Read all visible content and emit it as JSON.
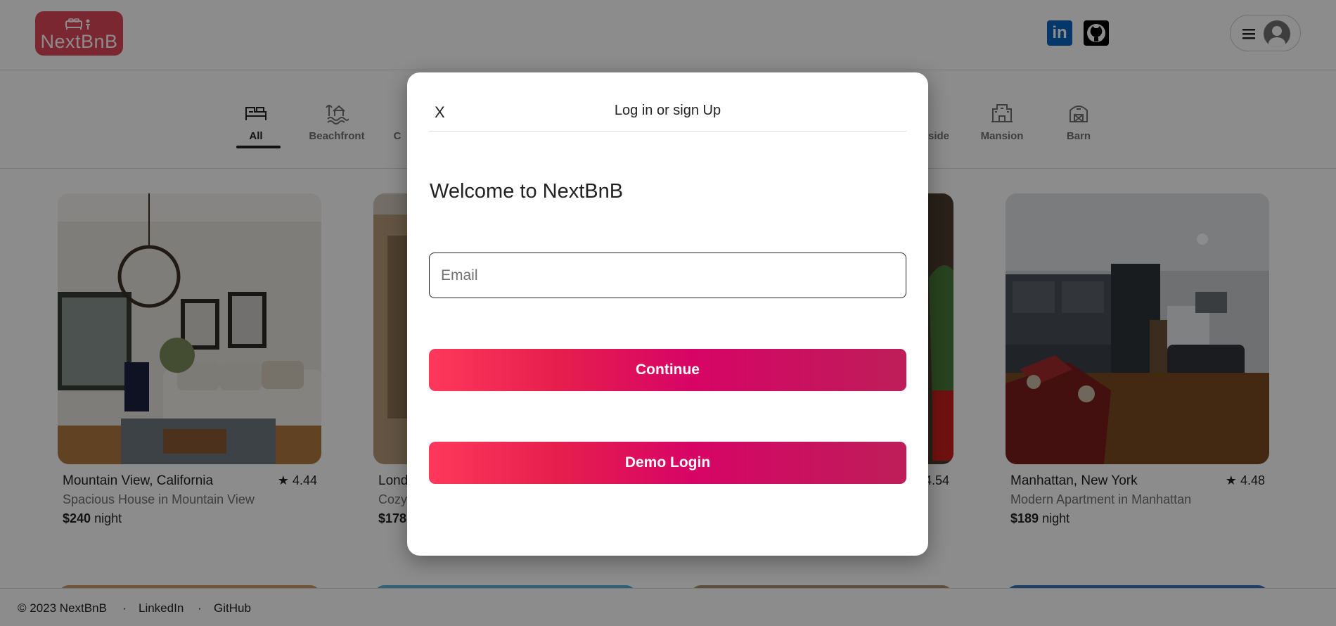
{
  "header": {
    "logo_text": "NextBnB",
    "linkedin_text": "in"
  },
  "categories": [
    {
      "label": "All",
      "icon": "bed-icon",
      "active": true
    },
    {
      "label": "Beachfront",
      "icon": "beach-icon"
    },
    {
      "label": "Mansion",
      "icon": "mansion-icon"
    },
    {
      "label": "Barn",
      "icon": "barn-icon"
    }
  ],
  "listings": [
    {
      "location": "Mountain View, California",
      "rating": "4.44",
      "description": "Spacious House in Mountain View",
      "price": "$240",
      "price_unit": "night"
    },
    {
      "location": "Manhattan, New York",
      "rating": "4.48",
      "description": "Modern Apartment in Manhattan",
      "price": "$189",
      "price_unit": "night"
    }
  ],
  "partial": {
    "loc2": "Lond",
    "desc2": "Cozy",
    "price2": "$178",
    "rating3": "4.54",
    "cat_cut1": "C",
    "cat_cut2": "side"
  },
  "footer": {
    "copyright": "© 2023 NextBnB",
    "sep": "·",
    "linkedin": "LinkedIn",
    "github": "GitHub"
  },
  "modal": {
    "close": "X",
    "title": "Log in or sign Up",
    "welcome": "Welcome to NextBnB",
    "email_placeholder": "Email",
    "continue_label": "Continue",
    "demo_label": "Demo Login"
  },
  "colors": {
    "brand": "#e0475a",
    "button_gradient_start": "#ff385c",
    "button_gradient_end": "#bd1e59"
  }
}
